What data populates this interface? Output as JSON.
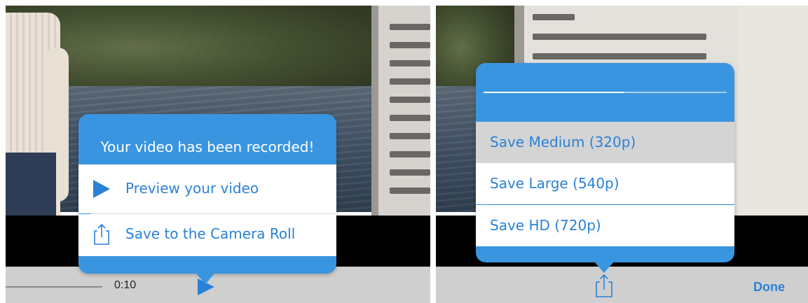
{
  "left_screen": {
    "popup": {
      "title": "Your video has been recorded!",
      "options": [
        {
          "label": "Preview your video",
          "icon": "play-icon"
        },
        {
          "label": "Save to the Camera Roll",
          "icon": "share-icon"
        }
      ]
    },
    "player": {
      "time": "0:10",
      "play_icon": "play-icon"
    }
  },
  "right_screen": {
    "popup": {
      "progress": 0.58,
      "options": [
        {
          "label": "Save Medium (320p)",
          "selected": true
        },
        {
          "label": "Save Large (540p)",
          "selected": false
        },
        {
          "label": "Save HD (720p)",
          "selected": false
        }
      ]
    },
    "toolbar": {
      "share_icon": "share-icon",
      "done_label": "Done"
    }
  },
  "colors": {
    "accent": "#3a95e0",
    "label_blue": "#2a82d8",
    "selected_row": "#d4d4d4",
    "toolbar_gray": "#cfcfcf"
  }
}
